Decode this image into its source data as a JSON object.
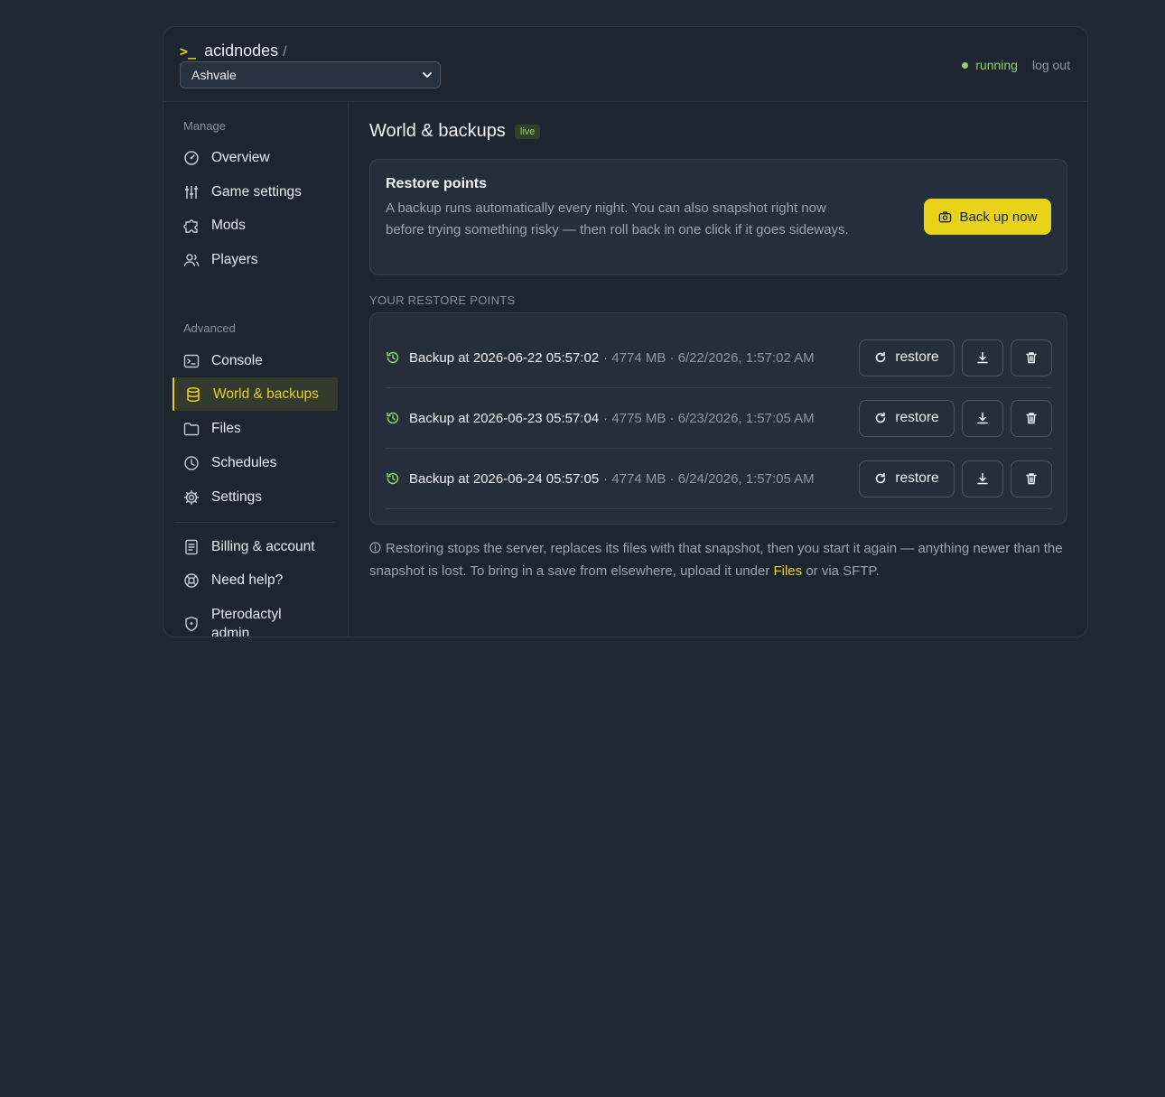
{
  "header": {
    "brand": "acidnodes",
    "prompt": ">_",
    "slash": "/",
    "server_selected": "Ashvale",
    "status": "running",
    "logout": "log out"
  },
  "sidebar": {
    "manage_label": "Manage",
    "advanced_label": "Advanced",
    "manage_items": [
      {
        "label": "Overview",
        "icon": "gauge-icon"
      },
      {
        "label": "Game settings",
        "icon": "sliders-icon"
      },
      {
        "label": "Mods",
        "icon": "puzzle-icon"
      },
      {
        "label": "Players",
        "icon": "users-icon"
      }
    ],
    "advanced_items": [
      {
        "label": "Console",
        "icon": "terminal-icon"
      },
      {
        "label": "World & backups",
        "icon": "database-icon",
        "active": true
      },
      {
        "label": "Files",
        "icon": "folder-icon"
      },
      {
        "label": "Schedules",
        "icon": "clock-icon"
      },
      {
        "label": "Settings",
        "icon": "gear-icon"
      }
    ],
    "footer_items": [
      {
        "label": "Billing & account",
        "icon": "receipt-icon"
      },
      {
        "label": "Need help?",
        "icon": "lifebuoy-icon"
      },
      {
        "label": "Pterodactyl admin",
        "icon": "shield-icon"
      }
    ]
  },
  "main": {
    "title": "World & backups",
    "badge": "live",
    "restore_card": {
      "title": "Restore points",
      "description": "A backup runs automatically every night. You can also snapshot right now before trying something risky — then roll back in one click if it goes sideways.",
      "button": "Back up now"
    },
    "list_label": "YOUR RESTORE POINTS",
    "backups": [
      {
        "name": "Backup at 2026-06-22 05:57:02",
        "meta": "· 4774 MB · 6/22/2026, 1:57:02 AM"
      },
      {
        "name": "Backup at 2026-06-23 05:57:04",
        "meta": "· 4775 MB · 6/23/2026, 1:57:05 AM"
      },
      {
        "name": "Backup at 2026-06-24 05:57:05",
        "meta": "· 4774 MB · 6/24/2026, 1:57:05 AM"
      }
    ],
    "restore_label": "restore",
    "note_before": "Restoring stops the server, replaces its files with that snapshot, then you start it again — anything newer than the snapshot is lost. To bring in a save from elsewhere, upload it under ",
    "note_link": "Files",
    "note_after": " or via SFTP."
  },
  "colors": {
    "background": "#1f2833",
    "accent": "#e8d21a",
    "success": "#8fd16a"
  }
}
